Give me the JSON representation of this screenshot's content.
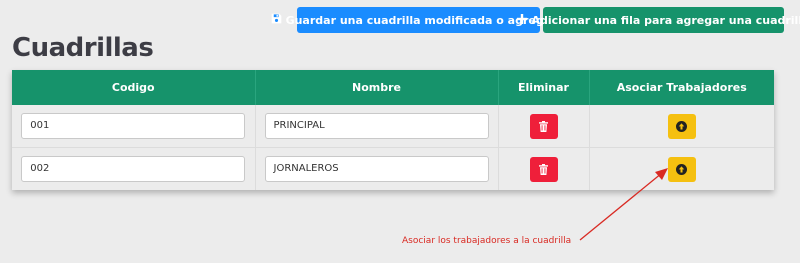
{
  "toolbar": {
    "save_label": "Guardar una cuadrilla modificada o agregada",
    "add_label": "Adicionar una fila para agregar una cuadrilla",
    "save_color": "#1a8cff",
    "add_color": "#16936b"
  },
  "page": {
    "title": "Cuadrillas"
  },
  "table": {
    "headers": [
      "Codigo",
      "Nombre",
      "Eliminar",
      "Asociar Trabajadores"
    ],
    "header_color": "#16936b",
    "rows": [
      {
        "codigo": "001",
        "nombre": "PRINCIPAL",
        "delete_icon": "trash-icon",
        "assoc_icon": "arrow-circle-up-icon"
      },
      {
        "codigo": "002",
        "nombre": "JORNALEROS",
        "delete_icon": "trash-icon",
        "assoc_icon": "arrow-circle-up-icon"
      }
    ]
  },
  "annotation": {
    "text": "Asociar los trabajadores a la cuadrilla",
    "color": "#d92a23"
  },
  "icons": {
    "save": "floppy-disk-icon",
    "add": "plus-icon",
    "delete": "trash-icon",
    "associate": "arrow-circle-up-icon"
  }
}
